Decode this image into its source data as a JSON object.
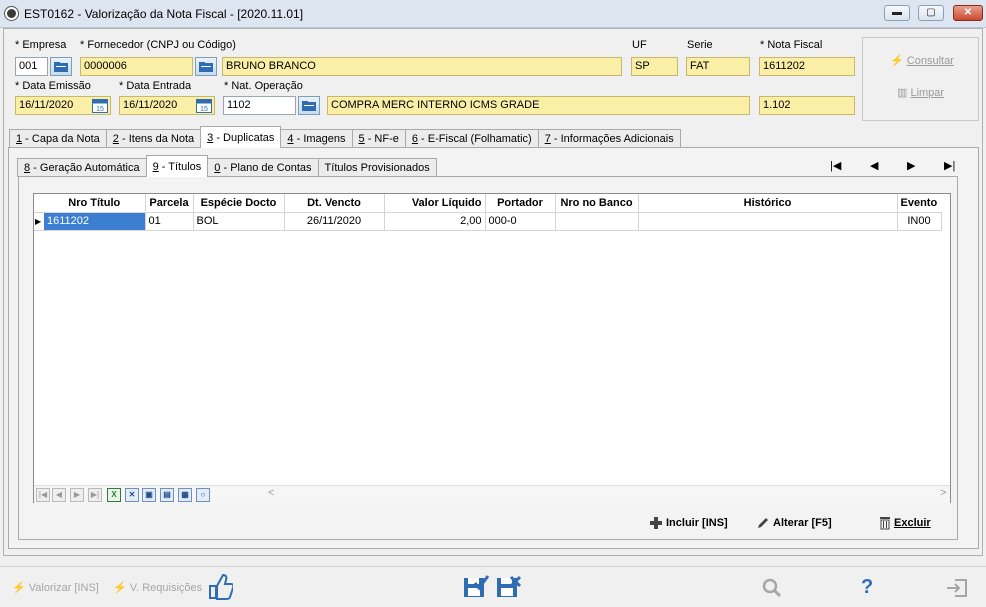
{
  "window": {
    "title": "EST0162 - Valorização da Nota Fiscal - [2020.11.01]",
    "min": "▬",
    "max": "▢",
    "close": "✕"
  },
  "header": {
    "empresa_label": "Empresa",
    "empresa_value": "001",
    "fornecedor_label": "Fornecedor (CNPJ ou Código)",
    "fornecedor_code": "0000006",
    "fornecedor_name": "BRUNO BRANCO",
    "uf_label": "UF",
    "uf_value": "SP",
    "serie_label": "Serie",
    "serie_value": "FAT",
    "nota_label": "Nota Fiscal",
    "nota_value": "1611202",
    "emissao_label": "Data Emissão",
    "emissao_value": "16/11/2020",
    "entrada_label": "Data Entrada",
    "entrada_value": "16/11/2020",
    "natop_label": "Nat. Operação",
    "natop_code": "1102",
    "natop_desc": "COMPRA MERC INTERNO ICMS GRADE",
    "natop_cfop": "1.102",
    "cal_day": "15"
  },
  "side": {
    "consultar": "Consultar",
    "limpar": "Limpar"
  },
  "tabs": [
    {
      "key": "1",
      "label": "Capa da Nota"
    },
    {
      "key": "2",
      "label": "Itens da Nota"
    },
    {
      "key": "3",
      "label": "Duplicatas"
    },
    {
      "key": "4",
      "label": "Imagens"
    },
    {
      "key": "5",
      "label": "NF-e"
    },
    {
      "key": "6",
      "label": "E-Fiscal (Folhamatic)"
    },
    {
      "key": "7",
      "label": "Informações Adicionais"
    }
  ],
  "subtabs": [
    {
      "key": "8",
      "label": "Geração Automática"
    },
    {
      "key": "9",
      "label": "Títulos"
    },
    {
      "key": "0",
      "label": "Plano de Contas"
    },
    {
      "key": "",
      "label": "Títulos Provisionados"
    }
  ],
  "nav": {
    "first": "|◀",
    "prev": "◀",
    "next": "▶",
    "last": "▶|"
  },
  "grid": {
    "columns": [
      "Nro Título",
      "Parcela",
      "Espécie Docto",
      "Dt. Vencto",
      "Valor Líquido",
      "Portador",
      "Nro no Banco",
      "Histórico",
      "Evento"
    ],
    "rows": [
      [
        "1611202",
        "01",
        "BOL",
        "26/11/2020",
        "2,00",
        "000-0",
        "",
        "",
        "IN00"
      ]
    ],
    "row_marker": "▶"
  },
  "gridbar": {
    "first": "|◀",
    "prev": "◀",
    "next": "▶",
    "last": "▶|",
    "scroll_left": "<",
    "scroll_right": ">"
  },
  "actions": {
    "incluir": "Incluir [INS]",
    "alterar": "Alterar [F5]",
    "excluir": "Excluir"
  },
  "bottom": {
    "valorizar": "Valorizar [INS]",
    "requisicoes": "V. Requisições"
  },
  "colors": {
    "selected": "#3c7fd1",
    "yellow_field": "#fbefa8",
    "accent_blue": "#2e6db4"
  }
}
